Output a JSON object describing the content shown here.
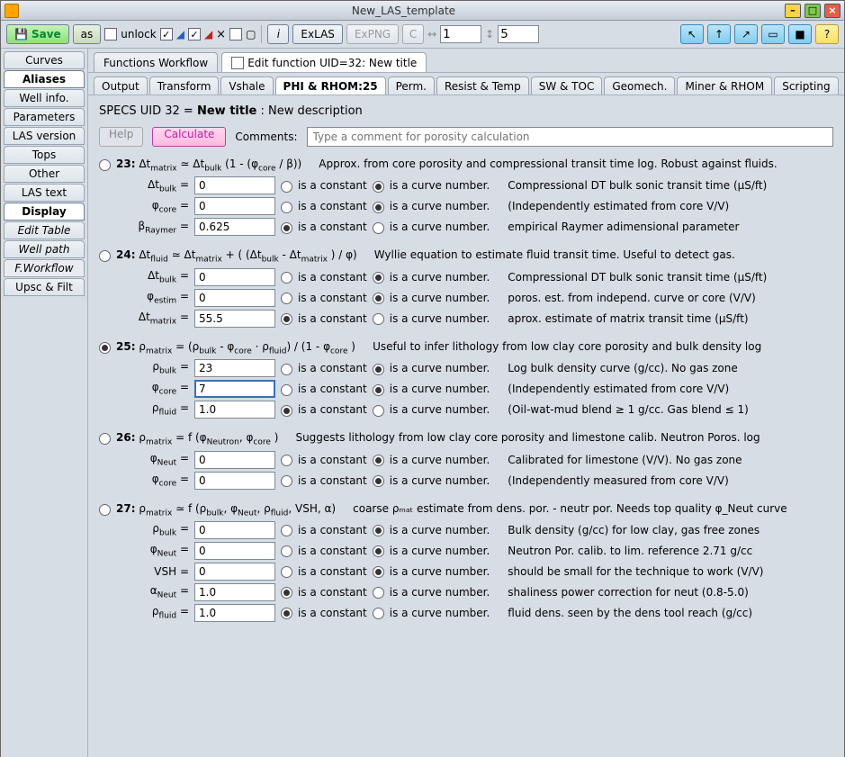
{
  "title": "New_LAS_template",
  "toolbar": {
    "save": "Save",
    "as": "as",
    "unlock": "unlock",
    "exlas": "ExLAS",
    "expng": "ExPNG",
    "c": "C",
    "arrow1": "1",
    "arrow2": "5",
    "info": "i",
    "help": "?"
  },
  "sidebar": [
    "Curves",
    "Aliases",
    "Well info.",
    "Parameters",
    "LAS version",
    "Tops",
    "Other",
    "LAS text",
    "Display",
    "Edit Table",
    "Well path",
    "F.Workflow",
    "Upsc & Filt"
  ],
  "tabs": {
    "fw": "Functions Workflow",
    "edit": "Edit function UID=32: New title"
  },
  "subtabs": [
    "Output",
    "Transform",
    "Vshale",
    "PHI & RHOM:25",
    "Perm.",
    "Resist & Temp",
    "SW & TOC",
    "Geomech.",
    "Miner & RHOM",
    "Scripting"
  ],
  "spec": {
    "pre": "SPECS UID 32 = ",
    "bold": "New title",
    "post": " : New description"
  },
  "actions": {
    "help": "Help",
    "calc": "Calculate",
    "comments": "Comments:",
    "placeholder": "Type a comment for porosity calculation"
  },
  "rlabels": {
    "const": "is a constant",
    "curve": "is a curve number."
  },
  "eq23": {
    "num": "23:",
    "formula": "Δtₘₐₜᵣᵢₓ ≃ Δt_bulk (1 - (φ_core / β))",
    "desc": "Approx. from core porosity and compressional transit time log. Robust against fluids.",
    "p1": {
      "l": "Δt_bulk =",
      "v": "0",
      "sel": "curve",
      "d": "Compressional DT bulk sonic transit time (μS/ft)"
    },
    "p2": {
      "l": "φ_core =",
      "v": "0",
      "sel": "curve",
      "d": "(Independently estimated from core V/V)"
    },
    "p3": {
      "l": "β_Raymer =",
      "v": "0.625",
      "sel": "const",
      "d": "empirical Raymer adimensional parameter"
    }
  },
  "eq24": {
    "num": "24:",
    "formula": "Δt_fluid ≃ Δtₘₐₜᵣᵢₓ + ( (Δt_bulk - Δtₘₐₜᵣᵢₓ ) / φ)",
    "desc": "Wyllie equation to estimate fluid transit time. Useful to detect gas.",
    "p1": {
      "l": "Δt_bulk =",
      "v": "0",
      "sel": "curve",
      "d": "Compressional DT bulk sonic transit time (μS/ft)"
    },
    "p2": {
      "l": "φ_estim =",
      "v": "0",
      "sel": "curve",
      "d": "poros. est. from independ. curve or core (V/V)"
    },
    "p3": {
      "l": "Δtₘₐₜᵣᵢₓ =",
      "v": "55.5",
      "sel": "const",
      "d": "aprox. estimate of matrix transit time (μS/ft)"
    }
  },
  "eq25": {
    "num": "25:",
    "formula": "ρₘₐₜᵣᵢₓ = (ρ_bulk - φ_core · ρ_fluid) / (1 - φ_core )",
    "desc": "Useful to infer lithology from low clay core porosity and bulk density log",
    "p1": {
      "l": "ρ_bulk =",
      "v": "23",
      "sel": "curve",
      "d": "Log bulk density curve (g/cc). No gas zone"
    },
    "p2": {
      "l": "φ_core =",
      "v": "7",
      "sel": "curve",
      "d": "(Independently estimated from core V/V)"
    },
    "p3": {
      "l": "ρ_fluid =",
      "v": "1.0",
      "sel": "const",
      "d": "(Oil-wat-mud blend ≥ 1 g/cc. Gas blend ≤ 1)"
    }
  },
  "eq26": {
    "num": "26:",
    "formula": "ρₘₐₜᵣᵢₓ = f (φ_Neutron, φ_core )",
    "desc": "Suggests lithology from low clay core porosity and limestone calib. Neutron Poros. log",
    "p1": {
      "l": "φ_Neut =",
      "v": "0",
      "sel": "curve",
      "d": "Calibrated for limestone (V/V). No gas zone"
    },
    "p2": {
      "l": "φ_core =",
      "v": "0",
      "sel": "curve",
      "d": "(Independently measured from core V/V)"
    }
  },
  "eq27": {
    "num": "27:",
    "formula": "ρₘₐₜᵣᵢₓ ≃ f (ρ_bulk, φ_Neut, ρ_fluid, VSH, α)",
    "desc": "coarse ρₘₐₜ estimate from dens. por. - neutr por. Needs top quality φ_Neut curve",
    "p1": {
      "l": "ρ_bulk =",
      "v": "0",
      "sel": "curve",
      "d": "Bulk density (g/cc) for low clay, gas free zones"
    },
    "p2": {
      "l": "φ_Neut =",
      "v": "0",
      "sel": "curve",
      "d": "Neutron Por. calib. to lim. reference 2.71 g/cc"
    },
    "p3": {
      "l": "VSH =",
      "v": "0",
      "sel": "curve",
      "d": "should be small for the technique to work (V/V)"
    },
    "p4": {
      "l": "α_Neut =",
      "v": "1.0",
      "sel": "const",
      "d": "shaliness power correction for neut (0.8-5.0)"
    },
    "p5": {
      "l": "ρ_fluid =",
      "v": "1.0",
      "sel": "const",
      "d": "fluid dens. seen by the dens tool reach (g/cc)"
    }
  }
}
